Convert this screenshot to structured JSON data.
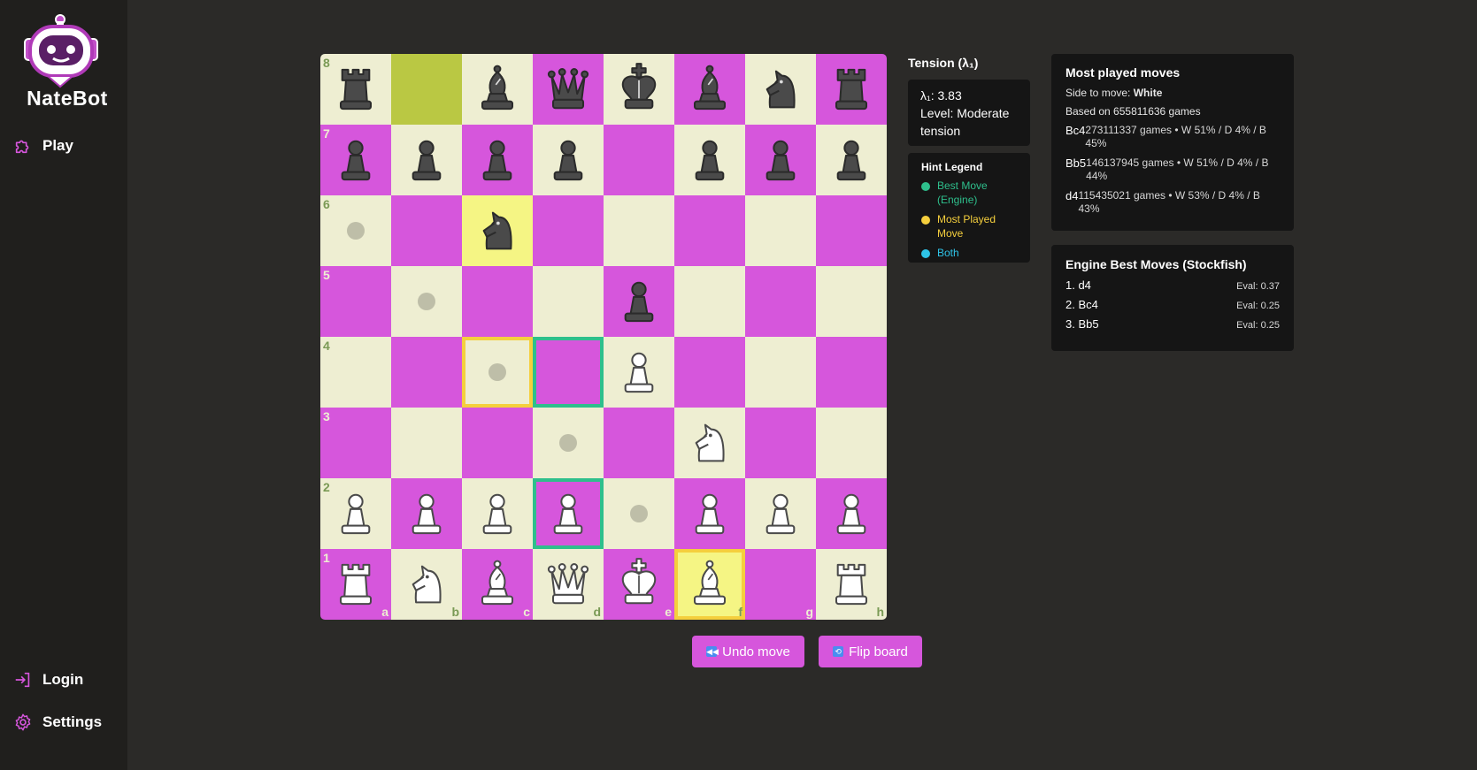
{
  "app": {
    "brand": "NateBot",
    "nav": {
      "play": "Play",
      "login": "Login",
      "settings": "Settings"
    },
    "accent_color": "#d656dc"
  },
  "board": {
    "files": [
      "a",
      "b",
      "c",
      "d",
      "e",
      "f",
      "g",
      "h"
    ],
    "ranks": [
      "8",
      "7",
      "6",
      "5",
      "4",
      "3",
      "2",
      "1"
    ],
    "light_color": "#eeeed2",
    "dark_color": "#d656dc",
    "position": {
      "a8": "bR",
      "c8": "bB",
      "d8": "bQ",
      "e8": "bK",
      "f8": "bB",
      "g8": "bN",
      "h8": "bR",
      "a7": "bP",
      "b7": "bP",
      "c7": "bP",
      "d7": "bP",
      "f7": "bP",
      "g7": "bP",
      "h7": "bP",
      "c6": "bN",
      "e5": "bP",
      "e4": "wP",
      "f3": "wN",
      "a2": "wP",
      "b2": "wP",
      "c2": "wP",
      "d2": "wP",
      "f2": "wP",
      "g2": "wP",
      "h2": "wP",
      "a1": "wR",
      "b1": "wN",
      "c1": "wB",
      "d1": "wQ",
      "e1": "wK",
      "f1": "wB",
      "h1": "wR"
    },
    "last_move_square": "b8",
    "selected_square": "c6",
    "move_dots": [
      "a6",
      "b5",
      "c4",
      "d3",
      "e2"
    ],
    "hint_best_squares": [
      "d4",
      "d2"
    ],
    "hint_most_squares": [
      "c4",
      "f1"
    ]
  },
  "buttons": {
    "undo": "Undo move",
    "flip": "Flip board"
  },
  "tension": {
    "title": "Tension (λ₁)",
    "value_line": "λ₁: 3.83",
    "level_line": "Level: Moderate tension"
  },
  "legend": {
    "title": "Hint Legend",
    "items": [
      {
        "label": "Best Move (Engine)",
        "color": "#2ebf8c"
      },
      {
        "label": "Most Played Move",
        "color": "#f5cf3d"
      },
      {
        "label": "Both",
        "color": "#2ec4e8"
      }
    ]
  },
  "most_played": {
    "title": "Most played moves",
    "side_label": "Side to move: ",
    "side_value": "White",
    "based_on": "Based on 655811636 games",
    "moves": [
      {
        "san": "Bc4",
        "stats": "273111337 games • W 51% / D 4% / B 45%"
      },
      {
        "san": "Bb5",
        "stats": "146137945 games • W 51% / D 4% / B 44%"
      },
      {
        "san": "d4",
        "stats": "115435021 games • W 53% / D 4% / B 43%"
      }
    ]
  },
  "engine": {
    "title": "Engine Best Moves (Stockfish)",
    "moves": [
      {
        "san": "1. d4",
        "eval": "Eval: 0.37"
      },
      {
        "san": "2. Bc4",
        "eval": "Eval: 0.25"
      },
      {
        "san": "3. Bb5",
        "eval": "Eval: 0.25"
      }
    ]
  }
}
